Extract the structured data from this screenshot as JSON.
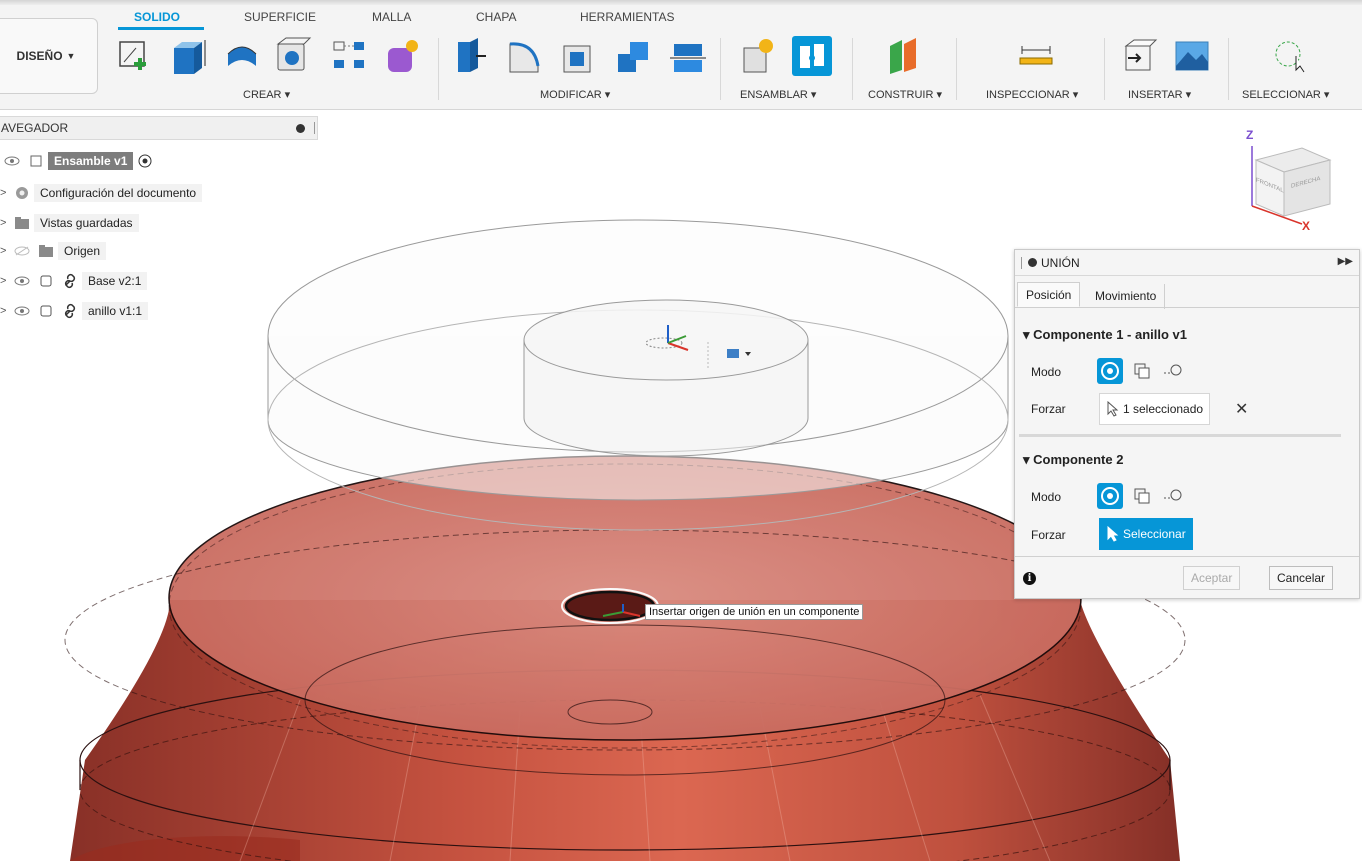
{
  "toolbar": {
    "tabs": [
      "SOLIDO",
      "SUPERFICIE",
      "MALLA",
      "CHAPA",
      "HERRAMIENTAS"
    ],
    "workspace_label": "DISEÑO",
    "groups": {
      "crear": "CREAR",
      "modificar": "MODIFICAR",
      "ensamblar": "ENSAMBLAR",
      "construir": "CONSTRUIR",
      "inspeccionar": "INSPECCIONAR",
      "insertar": "INSERTAR",
      "seleccionar": "SELECCIONAR"
    },
    "accent_color": "#0696d7"
  },
  "browser": {
    "title": "AVEGADOR",
    "items": [
      {
        "label": "Ensamble v1"
      },
      {
        "label": "Configuración del documento"
      },
      {
        "label": "Vistas guardadas"
      },
      {
        "label": "Origen"
      },
      {
        "label": "Base v2:1"
      },
      {
        "label": "anillo v1:1"
      }
    ]
  },
  "viewcube": {
    "axis_z": "Z",
    "axis_x": "X",
    "face_front": "FRONTAL",
    "face_right": "DERECHA"
  },
  "dialog": {
    "title": "UNIÓN",
    "tabs": [
      "Posición",
      "Movimiento"
    ],
    "component1": {
      "title": "Componente 1 - anillo v1",
      "mode_label": "Modo",
      "force_label": "Forzar",
      "selection": "1 seleccionado"
    },
    "component2": {
      "title": "Componente 2",
      "mode_label": "Modo",
      "force_label": "Forzar",
      "selection": "Seleccionar"
    },
    "ok_label": "Aceptar",
    "cancel_label": "Cancelar"
  },
  "tooltip": "Insertar origen de unión en un componente",
  "model_color": "#c0392b"
}
